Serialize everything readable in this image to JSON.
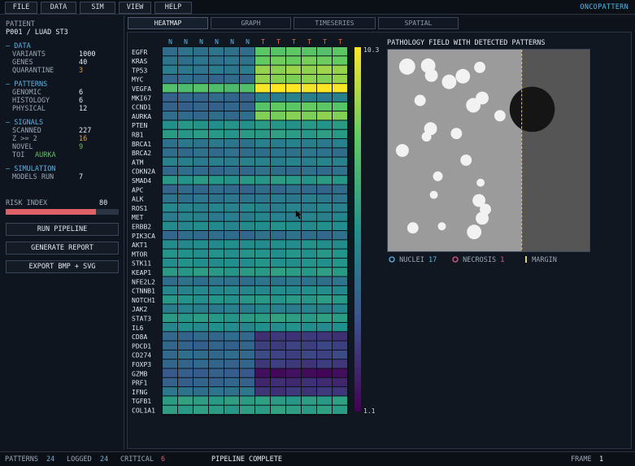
{
  "menu": [
    "FILE",
    "DATA",
    "SIM",
    "VIEW",
    "HELP"
  ],
  "app_title": "ONCOPATTERN",
  "patient": {
    "label": "PATIENT",
    "id": "P001 / LUAD ST3"
  },
  "sections": [
    {
      "title": "DATA",
      "rows": [
        {
          "label": "VARIANTS",
          "value": "1000"
        },
        {
          "label": "GENES",
          "value": "40"
        },
        {
          "label": "QUARANTINE",
          "value": "3",
          "tone": "warn"
        }
      ]
    },
    {
      "title": "PATTERNS",
      "rows": [
        {
          "label": "GENOMIC",
          "value": "6"
        },
        {
          "label": "HISTOLOGY",
          "value": "6"
        },
        {
          "label": "PHYSICAL",
          "value": "12"
        }
      ]
    },
    {
      "title": "SIGNALS",
      "rows": [
        {
          "label": "SCANNED",
          "value": "227"
        },
        {
          "label": "Z >= 2",
          "value": "16",
          "tone": "warn"
        },
        {
          "label": "NOVEL",
          "value": "9",
          "tone": "good"
        },
        {
          "label": "TOI",
          "value": "AURKA",
          "tone": "good"
        }
      ]
    },
    {
      "title": "SIMULATION",
      "rows": [
        {
          "label": "MODELS RUN",
          "value": "7"
        }
      ]
    }
  ],
  "risk": {
    "label": "RISK INDEX",
    "value": "80",
    "fraction": 0.8
  },
  "actions": {
    "run": "RUN PIPELINE",
    "report": "GENERATE REPORT",
    "export": "EXPORT BMP + SVG"
  },
  "tabs": [
    "HEATMAP",
    "GRAPH",
    "TIMESERIES",
    "SPATIAL"
  ],
  "active_tab": "HEATMAP",
  "heatmap": {
    "column_labels": [
      "N",
      "N",
      "N",
      "N",
      "N",
      "N",
      "T",
      "T",
      "T",
      "T",
      "T",
      "T"
    ],
    "genes": [
      "EGFR",
      "KRAS",
      "TP53",
      "MYC",
      "VEGFA",
      "MKI67",
      "CCND1",
      "AURKA",
      "PTEN",
      "RB1",
      "BRCA1",
      "BRCA2",
      "ATM",
      "CDKN2A",
      "SMAD4",
      "APC",
      "ALK",
      "ROS1",
      "MET",
      "ERBB2",
      "PIK3CA",
      "AKT1",
      "MTOR",
      "STK11",
      "KEAP1",
      "NFE2L2",
      "CTNNB1",
      "NOTCH1",
      "JAK2",
      "STAT3",
      "IL6",
      "CD8A",
      "PDCD1",
      "CD274",
      "FOXP3",
      "GZMB",
      "PRF1",
      "IFNG",
      "TGFB1",
      "COL1A1"
    ],
    "normal_values": [
      4.5,
      4.6,
      4.8,
      4.2,
      7.5,
      4.1,
      4.0,
      4.3,
      5.8,
      6.0,
      4.7,
      4.4,
      5.0,
      4.3,
      5.9,
      4.2,
      4.6,
      5.2,
      5.0,
      5.4,
      4.3,
      5.5,
      5.7,
      5.6,
      6.0,
      4.5,
      5.3,
      5.8,
      5.0,
      6.0,
      5.5,
      4.2,
      4.0,
      4.3,
      4.1,
      3.8,
      4.0,
      4.6,
      6.2,
      6.1
    ],
    "tumor_values": [
      7.8,
      8.2,
      8.8,
      8.6,
      10.3,
      5.0,
      7.9,
      8.5,
      5.9,
      6.1,
      5.0,
      4.6,
      5.1,
      4.4,
      6.0,
      4.3,
      4.8,
      5.1,
      5.1,
      5.6,
      4.4,
      5.6,
      5.8,
      5.7,
      6.1,
      4.6,
      5.5,
      6.0,
      5.1,
      6.2,
      5.6,
      2.6,
      2.9,
      3.0,
      2.7,
      1.4,
      2.3,
      2.6,
      6.1,
      6.2
    ],
    "scale_min": "1.1",
    "scale_max": "10.3",
    "colormap": [
      "#440154",
      "#3b528b",
      "#21918c",
      "#5ec962",
      "#fde725"
    ]
  },
  "pathology": {
    "title": "PATHOLOGY FIELD WITH DETECTED PATTERNS",
    "legend": {
      "nuclei_label": "NUCLEI",
      "nuclei_count": "17",
      "necrosis_label": "NECROSIS",
      "necrosis_count": "1",
      "margin_label": "MARGIN"
    },
    "colors": {
      "nuclei": "#5ab4e6",
      "necrosis": "#e05a8a",
      "margin": "#e8d070"
    }
  },
  "status": {
    "patterns_label": "PATTERNS",
    "patterns": "24",
    "logged_label": "LOGGED",
    "logged": "24",
    "critical_label": "CRITICAL",
    "critical": "6",
    "message": "PIPELINE COMPLETE",
    "frame_label": "FRAME",
    "frame": "1"
  }
}
